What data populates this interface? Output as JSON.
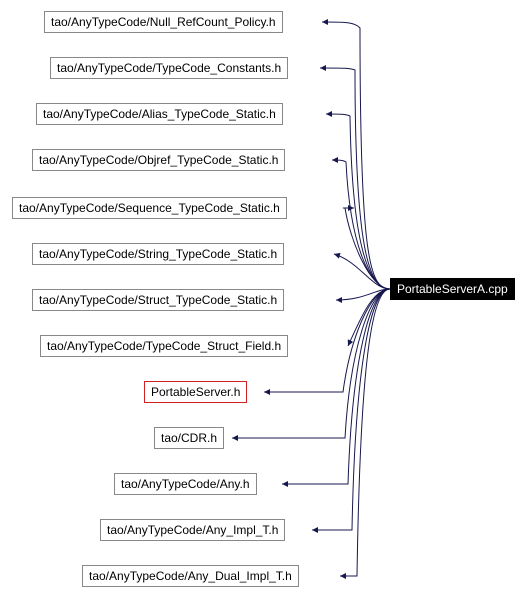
{
  "chart_data": {
    "type": "diagram",
    "root": "PortableServerA.cpp",
    "edges_from_root_to": [
      "tao/AnyTypeCode/Null_RefCount_Policy.h",
      "tao/AnyTypeCode/TypeCode_Constants.h",
      "tao/AnyTypeCode/Alias_TypeCode_Static.h",
      "tao/AnyTypeCode/Objref_TypeCode_Static.h",
      "tao/AnyTypeCode/Sequence_TypeCode_Static.h",
      "tao/AnyTypeCode/String_TypeCode_Static.h",
      "tao/AnyTypeCode/Struct_TypeCode_Static.h",
      "tao/AnyTypeCode/TypeCode_Struct_Field.h",
      "PortableServer.h",
      "tao/CDR.h",
      "tao/AnyTypeCode/Any.h",
      "tao/AnyTypeCode/Any_Impl_T.h",
      "tao/AnyTypeCode/Any_Dual_Impl_T.h"
    ]
  },
  "root": {
    "label": "PortableServerA.cpp"
  },
  "nodes": {
    "n0": {
      "label": "tao/AnyTypeCode/Null_RefCount_Policy.h"
    },
    "n1": {
      "label": "tao/AnyTypeCode/TypeCode_Constants.h"
    },
    "n2": {
      "label": "tao/AnyTypeCode/Alias_TypeCode_Static.h"
    },
    "n3": {
      "label": "tao/AnyTypeCode/Objref_TypeCode_Static.h"
    },
    "n4": {
      "label": "tao/AnyTypeCode/Sequence_TypeCode_Static.h"
    },
    "n5": {
      "label": "tao/AnyTypeCode/String_TypeCode_Static.h"
    },
    "n6": {
      "label": "tao/AnyTypeCode/Struct_TypeCode_Static.h"
    },
    "n7": {
      "label": "tao/AnyTypeCode/TypeCode_Struct_Field.h"
    },
    "n8": {
      "label": "PortableServer.h"
    },
    "n9": {
      "label": "tao/CDR.h"
    },
    "n10": {
      "label": "tao/AnyTypeCode/Any.h"
    },
    "n11": {
      "label": "tao/AnyTypeCode/Any_Impl_T.h"
    },
    "n12": {
      "label": "tao/AnyTypeCode/Any_Dual_Impl_T.h"
    }
  }
}
